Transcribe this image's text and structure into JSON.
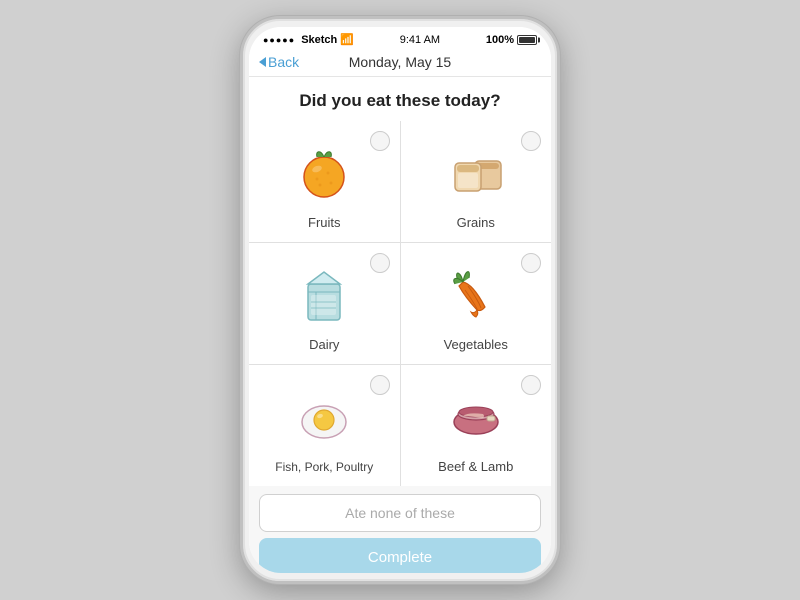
{
  "status_bar": {
    "signal_dots": "●●●●●",
    "network": "Sketch",
    "wifi": "WiFi",
    "time": "9:41 AM",
    "battery": "100%"
  },
  "nav": {
    "back_label": "Back",
    "title": "Monday, May 15"
  },
  "page": {
    "question": "Did you eat these today?",
    "food_items": [
      {
        "id": "fruits",
        "label": "Fruits"
      },
      {
        "id": "grains",
        "label": "Grains"
      },
      {
        "id": "dairy",
        "label": "Dairy"
      },
      {
        "id": "vegetables",
        "label": "Vegetables"
      },
      {
        "id": "fish-pork-poultry",
        "label": "Fish, Pork, Poultry"
      },
      {
        "id": "beef-lamb",
        "label": "Beef & Lamb"
      }
    ],
    "ate_none_label": "Ate none of these",
    "complete_label": "Complete"
  }
}
